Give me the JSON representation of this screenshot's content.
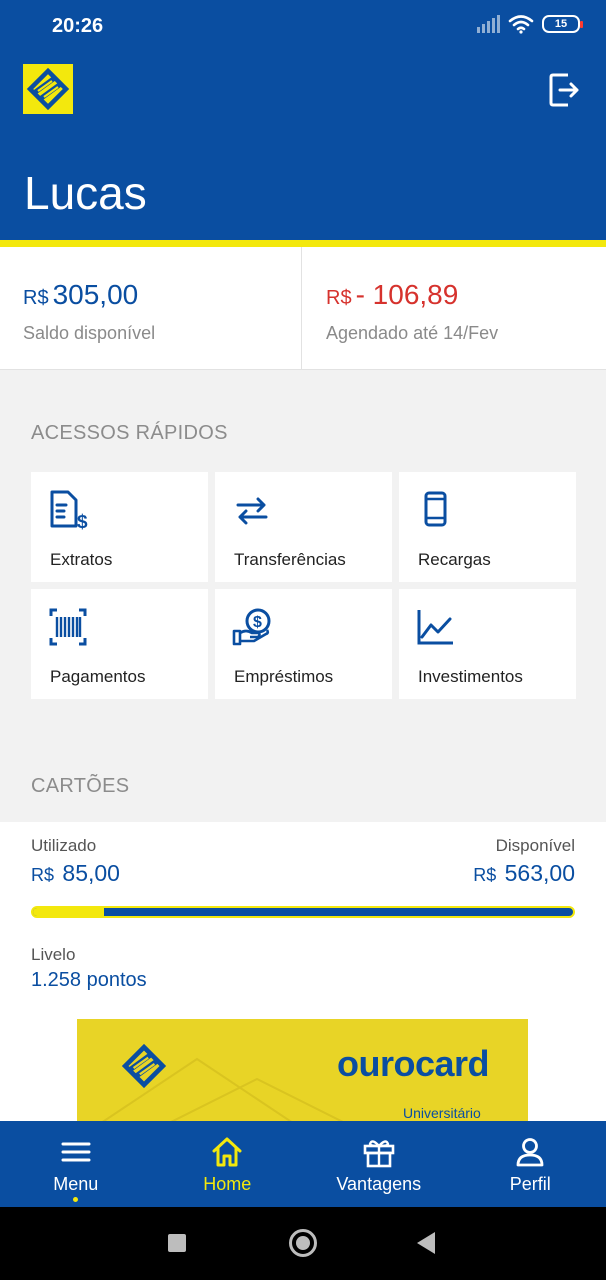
{
  "status_bar": {
    "time": "20:26",
    "battery": "15"
  },
  "header": {
    "user_name": "Lucas",
    "logo_icon": "bb-logo-icon",
    "logout_icon": "logout-icon"
  },
  "balance": {
    "available": {
      "currency": "R$",
      "amount": "305,00",
      "label": "Saldo disponível"
    },
    "scheduled": {
      "currency": "R$",
      "amount": "- 106,89",
      "label": "Agendado até 14/Fev"
    }
  },
  "quick_access": {
    "title": "ACESSOS RÁPIDOS",
    "items": [
      {
        "label": "Extratos",
        "icon": "statement-icon"
      },
      {
        "label": "Transferências",
        "icon": "transfer-icon"
      },
      {
        "label": "Recargas",
        "icon": "phone-icon"
      },
      {
        "label": "Pagamentos",
        "icon": "barcode-icon"
      },
      {
        "label": "Empréstimos",
        "icon": "loan-icon"
      },
      {
        "label": "Investimentos",
        "icon": "chart-icon"
      }
    ]
  },
  "cards": {
    "title": "CARTÕES",
    "used_label": "Utilizado",
    "used_currency": "R$",
    "used_value": "85,00",
    "available_label": "Disponível",
    "available_currency": "R$",
    "available_value": "563,00",
    "usage_fraction": 0.131,
    "points_label": "Livelo",
    "points_value": "1.258 pontos",
    "card_brand": "ourocard",
    "card_subtitle": "Universitário"
  },
  "bottom_nav": [
    {
      "label": "Menu",
      "icon": "menu-icon"
    },
    {
      "label": "Home",
      "icon": "home-icon",
      "active": true
    },
    {
      "label": "Vantagens",
      "icon": "gift-icon"
    },
    {
      "label": "Perfil",
      "icon": "user-icon"
    }
  ],
  "colors": {
    "primary": "#0a4ea1",
    "accent": "#f3e80d",
    "negative": "#d6322d"
  }
}
